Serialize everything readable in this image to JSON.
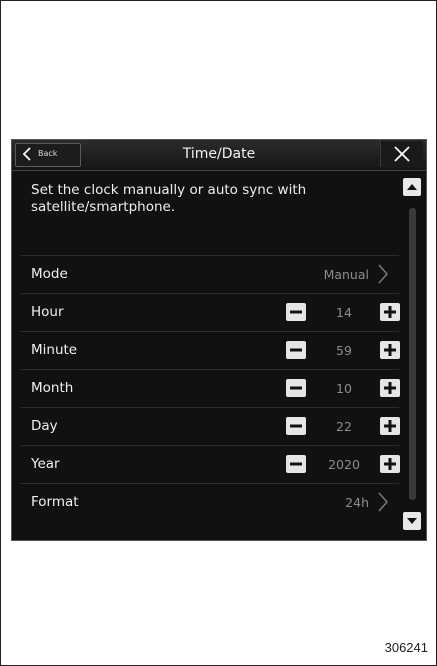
{
  "header": {
    "back_label": "Back",
    "title": "Time/Date"
  },
  "description": "Set the clock manually or auto sync with satellite/smartphone.",
  "rows": [
    {
      "label": "Mode",
      "value": "Manual"
    },
    {
      "label": "Hour",
      "value": "14"
    },
    {
      "label": "Minute",
      "value": "59"
    },
    {
      "label": "Month",
      "value": "10"
    },
    {
      "label": "Day",
      "value": "22"
    },
    {
      "label": "Year",
      "value": "2020"
    },
    {
      "label": "Format",
      "value": "24h"
    }
  ],
  "figure_number": "306241",
  "colors": {
    "screen_bg": "#111111",
    "text": "#f0f0f0",
    "value_text": "#8c8c8c",
    "button_bg": "#e6e6e6"
  }
}
